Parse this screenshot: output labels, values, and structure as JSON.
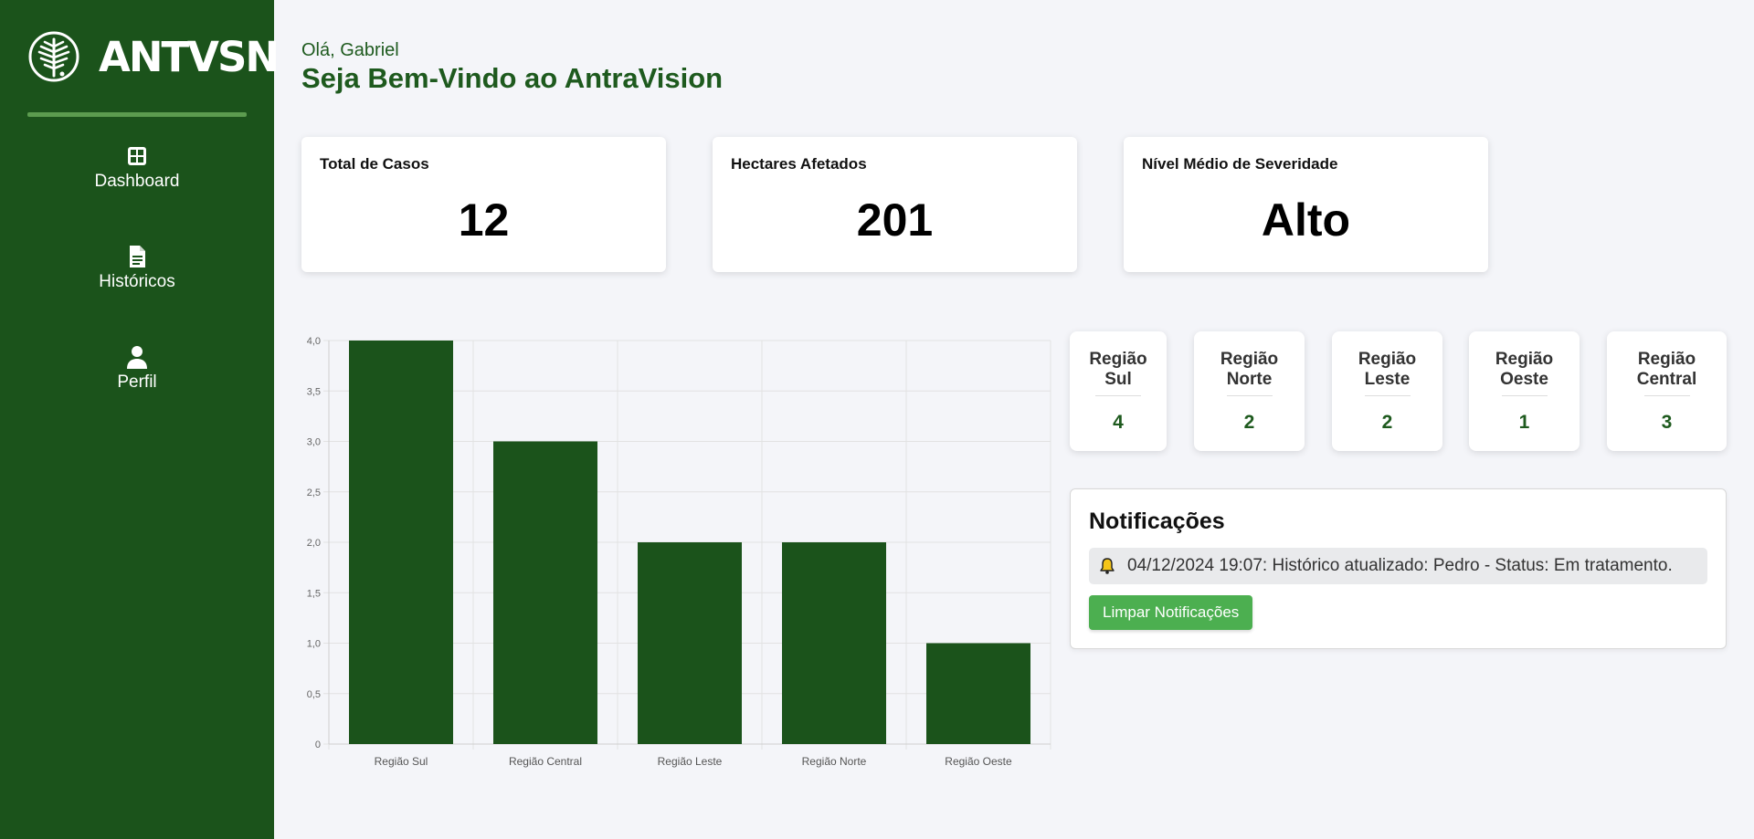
{
  "brand": {
    "logo_text": "ANTVSN"
  },
  "sidebar": {
    "items": [
      {
        "label": "Dashboard",
        "icon": "dashboard-grid-icon"
      },
      {
        "label": "Históricos",
        "icon": "document-icon"
      },
      {
        "label": "Perfil",
        "icon": "user-icon"
      }
    ]
  },
  "header": {
    "greeting": "Olá, Gabriel",
    "welcome": "Seja Bem-Vindo ao AntraVision"
  },
  "stats": [
    {
      "title": "Total de Casos",
      "value": "12"
    },
    {
      "title": "Hectares Afetados",
      "value": "201"
    },
    {
      "title": "Nível Médio de Severidade",
      "value": "Alto"
    }
  ],
  "regions": [
    {
      "name": "Região Sul",
      "count": "4"
    },
    {
      "name": "Região Norte",
      "count": "2"
    },
    {
      "name": "Região Leste",
      "count": "2"
    },
    {
      "name": "Região Oeste",
      "count": "1"
    },
    {
      "name": "Região Central",
      "count": "3"
    }
  ],
  "notifications": {
    "title": "Notificações",
    "items": [
      {
        "text": "04/12/2024 19:07: Histórico atualizado: Pedro - Status: Em tratamento.",
        "icon": "bell-icon"
      }
    ],
    "clear_label": "Limpar Notificações"
  },
  "colors": {
    "sidebar_bg": "#1b531b",
    "bar": "#1b531b",
    "accent_text": "#1e5a1e",
    "button": "#4caf50"
  },
  "chart_data": {
    "type": "bar",
    "categories": [
      "Região Sul",
      "Região Central",
      "Região Leste",
      "Região Norte",
      "Região Oeste"
    ],
    "values": [
      4,
      3,
      2,
      2,
      1
    ],
    "ylim": [
      0,
      4
    ],
    "yticks": [
      "0",
      "0,5",
      "1,0",
      "1,5",
      "2,0",
      "2,5",
      "3,0",
      "3,5",
      "4,0"
    ],
    "grid": true,
    "legend": "none"
  }
}
